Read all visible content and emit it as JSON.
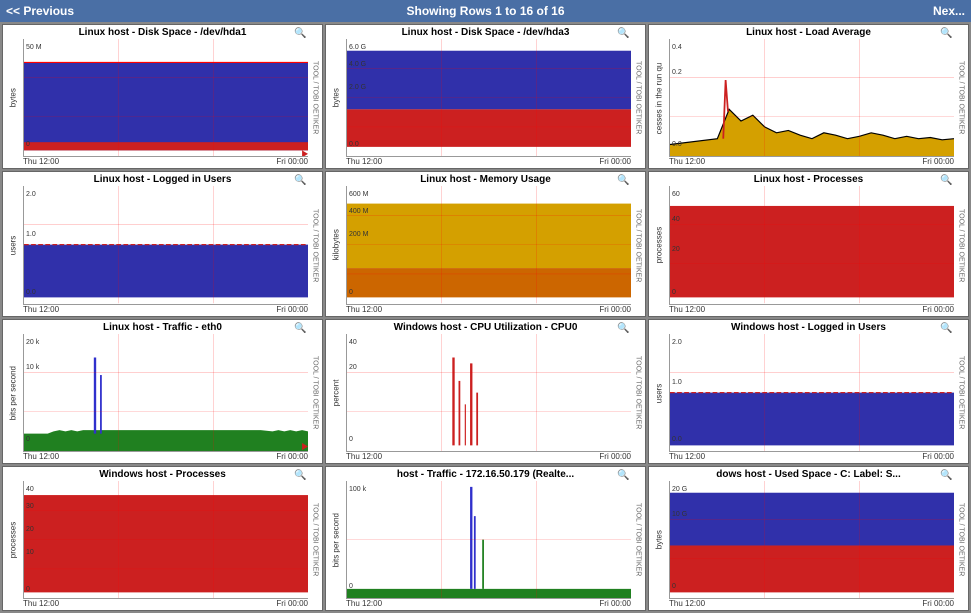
{
  "header": {
    "prev_label": "<< Previous",
    "center_label": "Showing Rows 1 to 16 of 16",
    "next_label": "Nex..."
  },
  "cells": [
    {
      "id": "disk-hda1",
      "title": "Linux host - Disk Space - /dev/hda1",
      "y_label": "bytes",
      "right_label": "TOOL / TOBI OETIKER",
      "x_start": "Thu 12:00",
      "x_end": "Fri 00:00",
      "chart_type": "disk_hda1",
      "y_ticks": [
        "50 M",
        "0"
      ]
    },
    {
      "id": "disk-hda3",
      "title": "Linux host - Disk Space - /dev/hda3",
      "y_label": "bytes",
      "right_label": "TOOL / TOBI OETIKER",
      "x_start": "Thu 12:00",
      "x_end": "Fri 00:00",
      "chart_type": "disk_hda3",
      "y_ticks": [
        "6.0 G",
        "4.0 G",
        "2.0 G",
        "0.0"
      ]
    },
    {
      "id": "load-avg",
      "title": "Linux host - Load Average",
      "y_label": "cesses in the run qu",
      "right_label": "TOOL / TOBI OETIKER",
      "x_start": "Thu 12:00",
      "x_end": "Fri 00:00",
      "chart_type": "load_avg",
      "y_ticks": [
        "0.4",
        "0.2",
        "0.0"
      ]
    },
    {
      "id": "logged-users",
      "title": "Linux host - Logged in Users",
      "y_label": "users",
      "right_label": "TOOL / TOBI OETIKER",
      "x_start": "Thu 12:00",
      "x_end": "Fri 00:00",
      "chart_type": "logged_users",
      "y_ticks": [
        "2.0",
        "1.0",
        "0.0"
      ]
    },
    {
      "id": "memory-usage",
      "title": "Linux host - Memory Usage",
      "y_label": "kilobytes",
      "right_label": "TOOL / TOBI OETIKER",
      "x_start": "Thu 12:00",
      "x_end": "Fri 00:00",
      "chart_type": "memory_usage",
      "y_ticks": [
        "600 M",
        "400 M",
        "200 M",
        "0"
      ]
    },
    {
      "id": "processes",
      "title": "Linux host - Processes",
      "y_label": "processes",
      "right_label": "TOOL / TOBI OETIKER",
      "x_start": "Thu 12:00",
      "x_end": "Fri 00:00",
      "chart_type": "linux_processes",
      "y_ticks": [
        "60",
        "40",
        "20",
        "0"
      ]
    },
    {
      "id": "traffic-eth0",
      "title": "Linux host - Traffic - eth0",
      "y_label": "bits per second",
      "right_label": "TOOL / TOBI OETIKER",
      "x_start": "Thu 12:00",
      "x_end": "Fri 00:00",
      "chart_type": "traffic_eth0",
      "y_ticks": [
        "20 k",
        "10 k",
        "0"
      ]
    },
    {
      "id": "cpu-util",
      "title": "Windows host - CPU Utilization - CPU0",
      "y_label": "percent",
      "right_label": "TOOL / TOBI OETIKER",
      "x_start": "Thu 12:00",
      "x_end": "Fri 00:00",
      "chart_type": "cpu_util",
      "y_ticks": [
        "40",
        "20",
        "0"
      ]
    },
    {
      "id": "win-logged-users",
      "title": "Windows host - Logged in Users",
      "y_label": "users",
      "right_label": "TOOL / TOBI OETIKER",
      "x_start": "Thu 12:00",
      "x_end": "Fri 00:00",
      "chart_type": "win_logged_users",
      "y_ticks": [
        "2.0",
        "1.0",
        "0.0"
      ]
    },
    {
      "id": "win-processes",
      "title": "Windows host - Processes",
      "y_label": "processes",
      "right_label": "TOOL / TOBI OETIKER",
      "x_start": "Thu 12:00",
      "x_end": "Fri 00:00",
      "chart_type": "win_processes",
      "y_ticks": [
        "40",
        "30",
        "20",
        "10",
        "0"
      ]
    },
    {
      "id": "traffic-172",
      "title": "host - Traffic - 172.16.50.179 (Realte...",
      "y_label": "bits per second",
      "right_label": "TOOL / TOBI OETIKER",
      "x_start": "Thu 12:00",
      "x_end": "Fri 00:00",
      "chart_type": "traffic_172",
      "y_ticks": [
        "100 k",
        "0"
      ]
    },
    {
      "id": "used-space",
      "title": "dows host - Used Space - C: Label: S...",
      "y_label": "bytes",
      "right_label": "TOOL / TOBI OETIKER",
      "x_start": "Thu 12:00",
      "x_end": "Fri 00:00",
      "chart_type": "used_space",
      "y_ticks": [
        "20 G",
        "10 G",
        "0"
      ]
    }
  ]
}
